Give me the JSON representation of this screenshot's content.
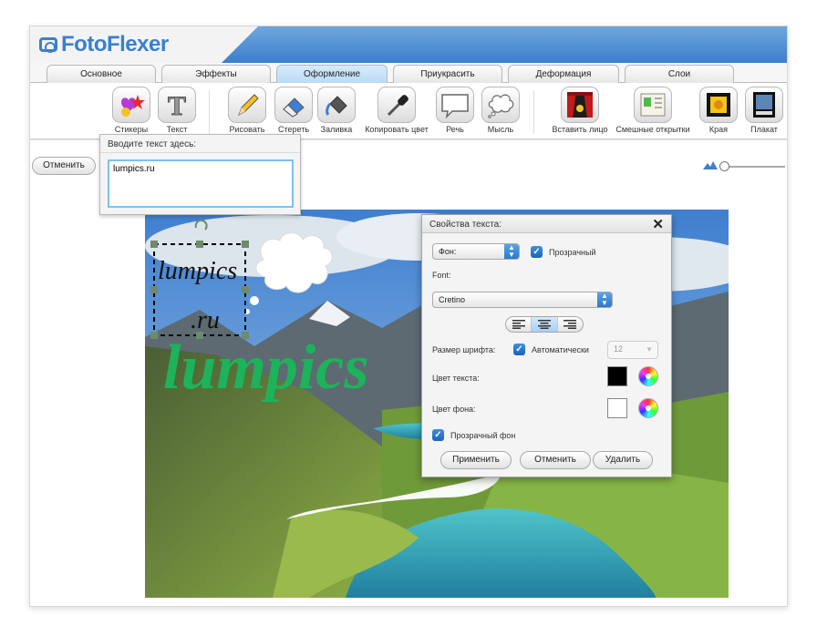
{
  "app": {
    "logo_text": "FotoFlexer"
  },
  "tabs": [
    "Основное",
    "Эффекты",
    "Оформление",
    "Приукрасить",
    "Деформация",
    "Слои"
  ],
  "active_tab": "Оформление",
  "tools": {
    "stickers": "Стикеры",
    "text": "Текст",
    "draw": "Рисовать",
    "erase": "Стереть",
    "fill": "Заливка",
    "copy_color": "Копировать цвет",
    "speech": "Речь",
    "thought": "Мысль",
    "insert_face": "Вставить лицо",
    "funny_cards": "Смешные открытки",
    "edges": "Края",
    "poster": "Плакат"
  },
  "undo_label": "Отменить",
  "text_panel": {
    "title": "Вводите текст здесь:",
    "value": "lumpics.ru"
  },
  "canvas": {
    "selected_text_line1": "lumpics",
    "selected_text_line2": ".ru",
    "big_text": "lumpics"
  },
  "props": {
    "title": "Свойства текста:",
    "bg_select": "Фон:",
    "transparent_label": "Прозрачный",
    "font_label": "Font:",
    "font_value": "Cretino",
    "font_size_label": "Размер шрифта:",
    "auto_label": "Автоматически",
    "font_size_value": "12",
    "text_color_label": "Цвет текста:",
    "bg_color_label": "Цвет фона:",
    "transparent_bg_label": "Прозрачный фон",
    "apply": "Применить",
    "cancel": "Отменить",
    "delete": "Удалить"
  },
  "colors": {
    "accent": "#3a7fd0",
    "text_color": "#000000",
    "bg_color": "#ffffff",
    "big_text_color": "#1db35a"
  }
}
